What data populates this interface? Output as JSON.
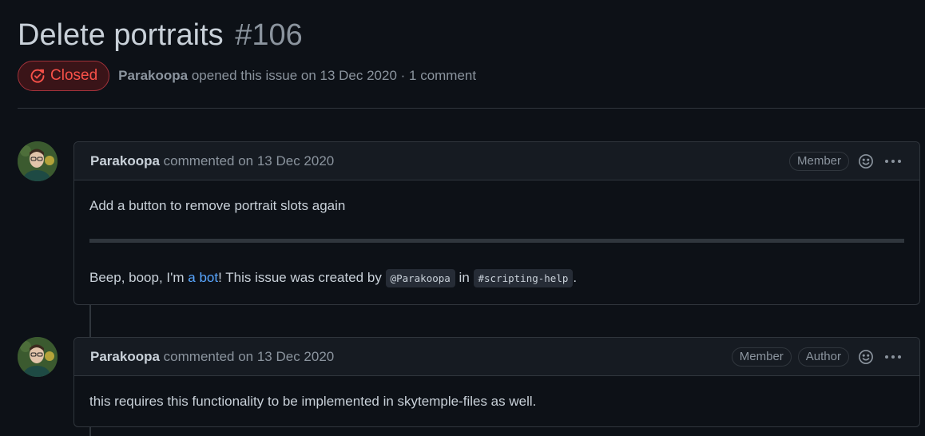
{
  "issue": {
    "title": "Delete portraits",
    "number": "#106",
    "state": "Closed",
    "author": "Parakoopa",
    "opened_text": "opened this issue on 13 Dec 2020 · 1 comment"
  },
  "colors": {
    "closed": "#f85149",
    "link": "#58a6ff",
    "background": "#0d1117"
  },
  "comments": [
    {
      "author": "Parakoopa",
      "action": "commented on 13 Dec 2020",
      "badges": [
        "Member"
      ],
      "body_line1": "Add a button to remove portrait slots again",
      "bot_prefix": "Beep, boop, I'm ",
      "bot_link": "a bot",
      "bot_middle": "! This issue was created by ",
      "mention_code": "@Parakoopa",
      "bot_in": " in ",
      "channel_code": "#scripting-help",
      "bot_end": "."
    },
    {
      "author": "Parakoopa",
      "action": "commented on 13 Dec 2020",
      "badges": [
        "Member",
        "Author"
      ],
      "body_line1": "this requires this functionality to be implemented in skytemple-files as well."
    }
  ],
  "icons": {
    "state": "issue-closed-icon",
    "reaction": "smiley-icon",
    "menu": "kebab-horizontal-icon"
  }
}
